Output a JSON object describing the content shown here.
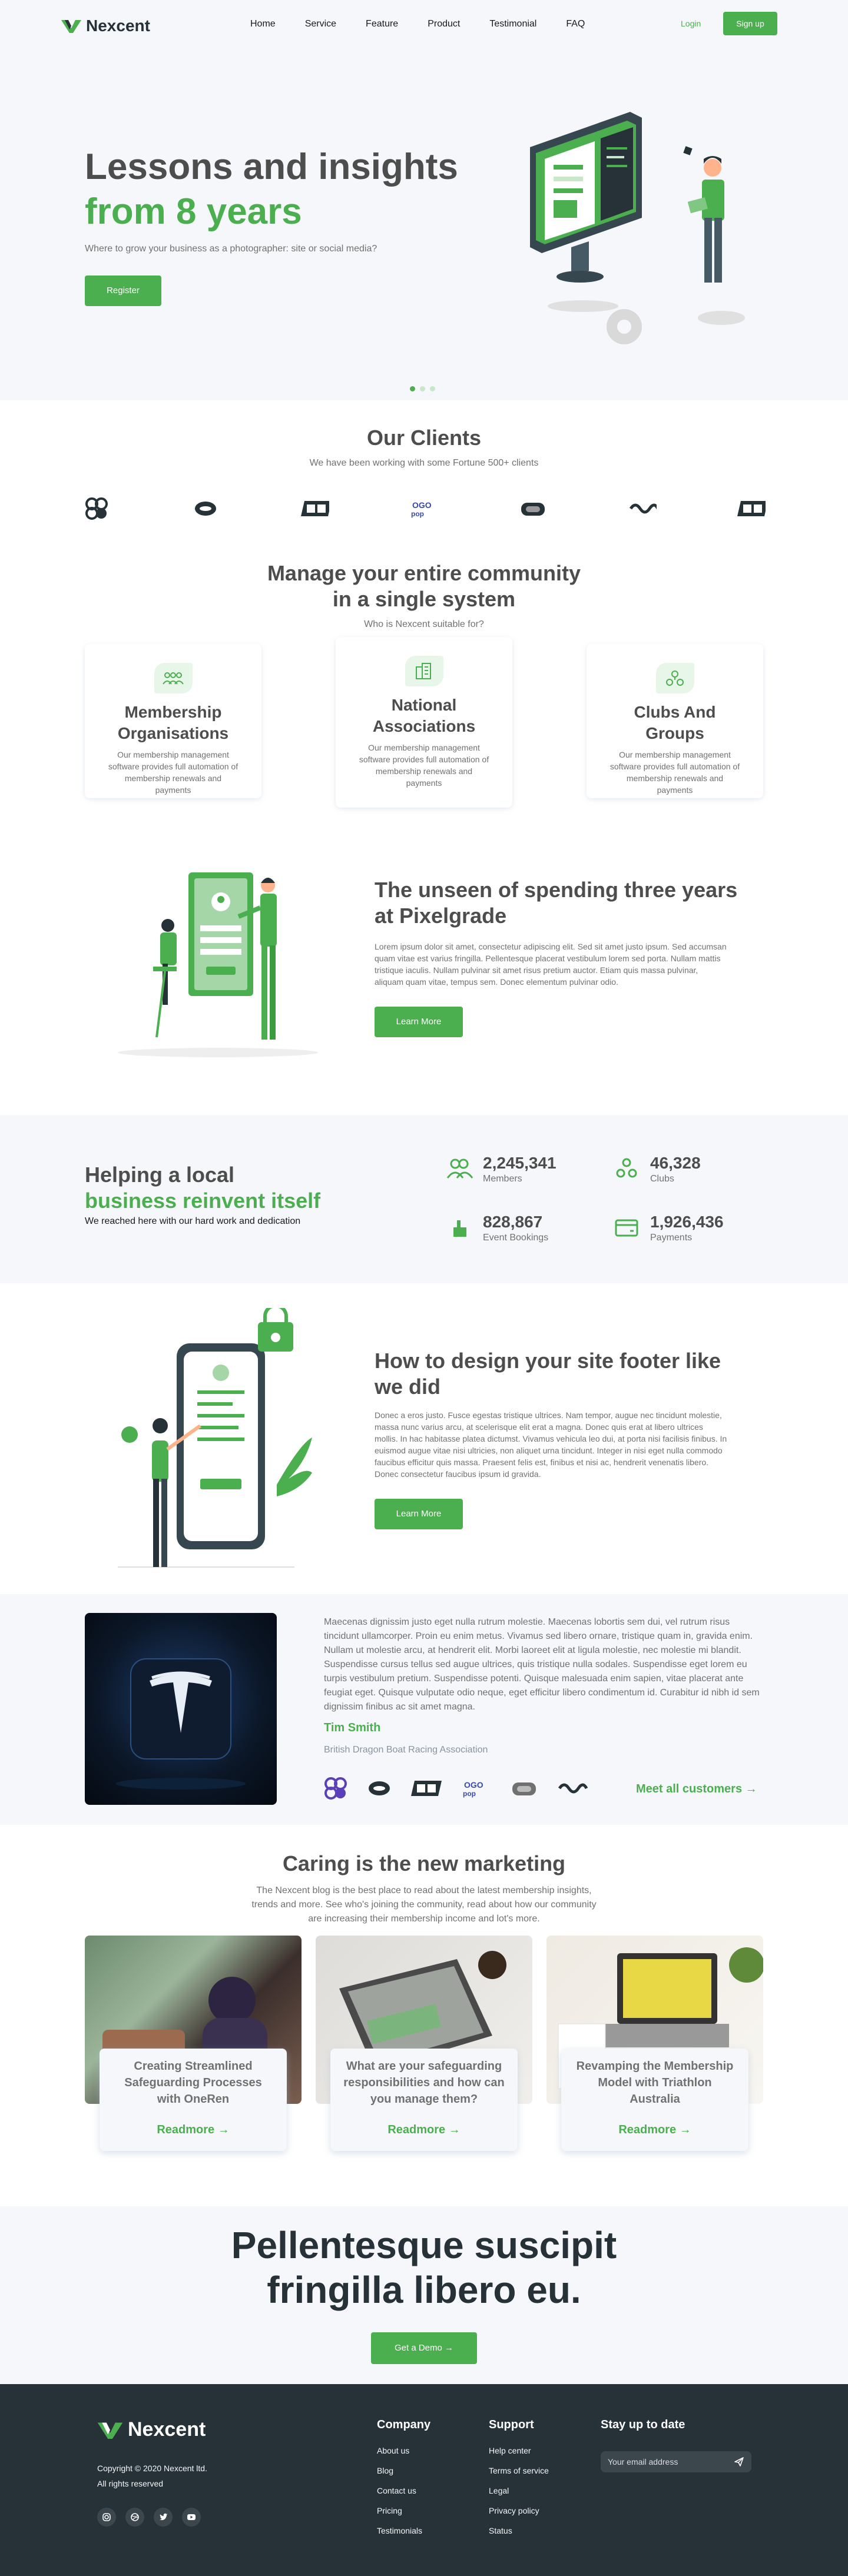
{
  "header": {
    "brand": "Nexcent",
    "nav": [
      "Home",
      "Service",
      "Feature",
      "Product",
      "Testimonial",
      "FAQ"
    ],
    "login": "Login",
    "signup": "Sign up"
  },
  "hero": {
    "line1": "Lessons and insights",
    "line2": "from 8 years",
    "subtitle": "Where to grow your business as a photographer: site or social media?",
    "cta": "Register",
    "slide_active": 1,
    "slide_count": 3
  },
  "clients": {
    "title": "Our Clients",
    "subtitle": "We have been working with some Fortune 500+ clients"
  },
  "community": {
    "title1": "Manage your entire community",
    "title2": "in a single system",
    "subtitle": "Who is Nexcent suitable for?",
    "cards": [
      {
        "title": "Membership Organisations",
        "text": "Our membership management software provides full automation of membership renewals and payments",
        "icon": "people-icon"
      },
      {
        "title": "National Associations",
        "text": "Our membership management software provides full automation of membership renewals and payments",
        "icon": "building-icon"
      },
      {
        "title": "Clubs And Groups",
        "text": "Our membership management software provides full automation of membership renewals and payments",
        "icon": "hands-icon"
      }
    ]
  },
  "feature1": {
    "title": "The unseen of spending three years at Pixelgrade",
    "body": "Lorem ipsum dolor sit amet, consectetur adipiscing elit. Sed sit amet justo ipsum. Sed accumsan quam vitae est varius fringilla. Pellentesque placerat vestibulum lorem sed porta. Nullam mattis tristique iaculis. Nullam pulvinar sit amet risus pretium auctor. Etiam quis massa pulvinar, aliquam quam vitae, tempus sem. Donec elementum pulvinar odio.",
    "cta": "Learn More"
  },
  "stats": {
    "title1": "Helping a local",
    "title2": "business reinvent itself",
    "subtitle": "We reached here with our hard work and dedication",
    "items": [
      {
        "value": "2,245,341",
        "label": "Members"
      },
      {
        "value": "46,328",
        "label": "Clubs"
      },
      {
        "value": "828,867",
        "label": "Event Bookings"
      },
      {
        "value": "1,926,436",
        "label": "Payments"
      }
    ]
  },
  "feature2": {
    "title": "How to design your site footer like we did",
    "body": "Donec a eros justo. Fusce egestas tristique ultrices. Nam tempor, augue nec tincidunt molestie, massa nunc varius arcu, at scelerisque elit erat a magna. Donec quis erat at libero ultrices mollis. In hac habitasse platea dictumst. Vivamus vehicula leo dui, at porta nisi facilisis finibus. In euismod augue vitae nisi ultricies, non aliquet urna tincidunt. Integer in nisi eget nulla commodo faucibus efficitur quis massa. Praesent felis est, finibus et nisi ac, hendrerit venenatis libero. Donec consectetur faucibus ipsum id gravida.",
    "cta": "Learn More"
  },
  "testimonial": {
    "quote": "Maecenas dignissim justo eget nulla rutrum molestie. Maecenas lobortis sem dui, vel rutrum risus tincidunt ullamcorper. Proin eu enim metus. Vivamus sed libero ornare, tristique quam in, gravida enim. Nullam ut molestie arcu, at hendrerit elit. Morbi laoreet elit at ligula molestie, nec molestie mi blandit. Suspendisse cursus tellus sed augue ultrices, quis tristique nulla sodales. Suspendisse eget lorem eu turpis vestibulum pretium. Suspendisse potenti. Quisque malesuada enim sapien, vitae placerat ante feugiat eget. Quisque vulputate odio neque, eget efficitur libero condimentum id. Curabitur id nibh id sem dignissim finibus ac sit amet magna.",
    "name": "Tim Smith",
    "role": "British Dragon Boat Racing Association",
    "more": "Meet all customers"
  },
  "blog": {
    "title": "Caring is the new marketing",
    "subtitle1": "The Nexcent blog is the best place to read about the latest membership insights,",
    "subtitle2": "trends and more. See who's joining the community, read about how our community",
    "subtitle3": "are increasing their membership income and lot's more.",
    "posts": [
      {
        "title": "Creating Streamlined Safeguarding Processes with OneRen",
        "more": "Readmore"
      },
      {
        "title": "What are your safeguarding responsibilities and how can you manage them?",
        "more": "Readmore"
      },
      {
        "title": "Revamping the Membership Model with Triathlon Australia",
        "more": "Readmore"
      }
    ]
  },
  "cta": {
    "line1": "Pellentesque suscipit",
    "line2": "fringilla libero eu.",
    "button": "Get a Demo"
  },
  "footer": {
    "brand": "Nexcent",
    "copyright": "Copyright © 2020 Nexcent ltd.",
    "rights": "All rights reserved",
    "company": {
      "title": "Company",
      "links": [
        "About us",
        "Blog",
        "Contact us",
        "Pricing",
        "Testimonials"
      ]
    },
    "support": {
      "title": "Support",
      "links": [
        "Help center",
        "Terms of service",
        "Legal",
        "Privacy policy",
        "Status"
      ]
    },
    "newsletter": {
      "title": "Stay up to date",
      "placeholder": "Your email address"
    }
  },
  "colors": {
    "primary": "#4caf4f",
    "dark": "#263238",
    "bg": "#f5f7fa",
    "text": "#4d4d4d",
    "muted": "#717171"
  }
}
